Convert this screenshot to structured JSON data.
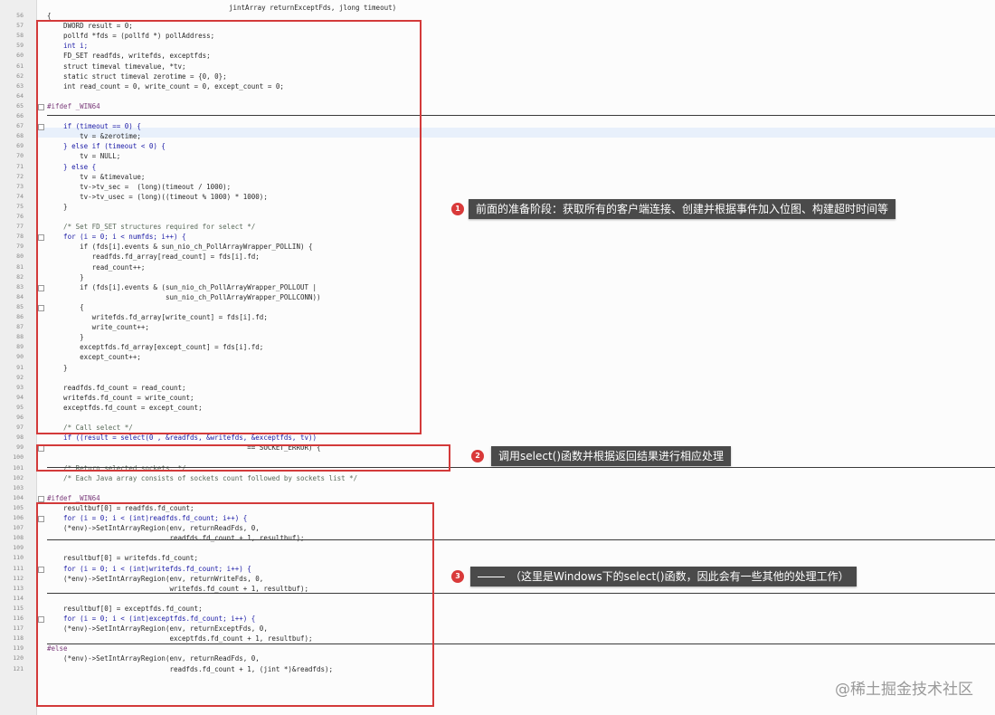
{
  "top_signature": "jintArray returnExceptFds, jlong timeout)",
  "code_lines": [
    {
      "ln": "56",
      "text": "{",
      "cls": ""
    },
    {
      "ln": "57",
      "text": "    DWORD result = 0;",
      "cls": ""
    },
    {
      "ln": "58",
      "text": "    pollfd *fds = (pollfd *) pollAddress;",
      "cls": ""
    },
    {
      "ln": "59",
      "text": "    int i;",
      "cls": "kw"
    },
    {
      "ln": "60",
      "text": "    FD_SET readfds, writefds, exceptfds;",
      "cls": ""
    },
    {
      "ln": "61",
      "text": "    struct timeval timevalue, *tv;",
      "cls": ""
    },
    {
      "ln": "62",
      "text": "    static struct timeval zerotime = {0, 0};",
      "cls": ""
    },
    {
      "ln": "63",
      "text": "    int read_count = 0, write_count = 0, except_count = 0;",
      "cls": ""
    },
    {
      "ln": "64",
      "text": "",
      "cls": ""
    },
    {
      "ln": "65",
      "text": "#ifdef _WIN64",
      "cls": "pp"
    },
    {
      "ln": "66",
      "text": "",
      "cls": ""
    },
    {
      "ln": "67",
      "text": "    if (timeout == 0) {",
      "cls": "kw"
    },
    {
      "ln": "68",
      "text": "        tv = &zerotime;",
      "cls": ""
    },
    {
      "ln": "69",
      "text": "    } else if (timeout < 0) {",
      "cls": "kw"
    },
    {
      "ln": "70",
      "text": "        tv = NULL;",
      "cls": ""
    },
    {
      "ln": "71",
      "text": "    } else {",
      "cls": "kw"
    },
    {
      "ln": "72",
      "text": "        tv = &timevalue;",
      "cls": ""
    },
    {
      "ln": "73",
      "text": "        tv->tv_sec =  (long)(timeout / 1000);",
      "cls": ""
    },
    {
      "ln": "74",
      "text": "        tv->tv_usec = (long)((timeout % 1000) * 1000);",
      "cls": ""
    },
    {
      "ln": "75",
      "text": "    }",
      "cls": ""
    },
    {
      "ln": "76",
      "text": "",
      "cls": ""
    },
    {
      "ln": "77",
      "text": "    /* Set FD_SET structures required for select */",
      "cls": "cm"
    },
    {
      "ln": "78",
      "text": "    for (i = 0; i < numfds; i++) {",
      "cls": "kw"
    },
    {
      "ln": "79",
      "text": "        if (fds[i].events & sun_nio_ch_PollArrayWrapper_POLLIN) {",
      "cls": ""
    },
    {
      "ln": "80",
      "text": "           readfds.fd_array[read_count] = fds[i].fd;",
      "cls": ""
    },
    {
      "ln": "81",
      "text": "           read_count++;",
      "cls": ""
    },
    {
      "ln": "82",
      "text": "        }",
      "cls": ""
    },
    {
      "ln": "83",
      "text": "        if (fds[i].events & (sun_nio_ch_PollArrayWrapper_POLLOUT |",
      "cls": ""
    },
    {
      "ln": "84",
      "text": "                             sun_nio_ch_PollArrayWrapper_POLLCONN))",
      "cls": ""
    },
    {
      "ln": "85",
      "text": "        {",
      "cls": ""
    },
    {
      "ln": "86",
      "text": "           writefds.fd_array[write_count] = fds[i].fd;",
      "cls": ""
    },
    {
      "ln": "87",
      "text": "           write_count++;",
      "cls": ""
    },
    {
      "ln": "88",
      "text": "        }",
      "cls": ""
    },
    {
      "ln": "89",
      "text": "        exceptfds.fd_array[except_count] = fds[i].fd;",
      "cls": ""
    },
    {
      "ln": "90",
      "text": "        except_count++;",
      "cls": ""
    },
    {
      "ln": "91",
      "text": "    }",
      "cls": ""
    },
    {
      "ln": "92",
      "text": "",
      "cls": ""
    },
    {
      "ln": "93",
      "text": "    readfds.fd_count = read_count;",
      "cls": ""
    },
    {
      "ln": "94",
      "text": "    writefds.fd_count = write_count;",
      "cls": ""
    },
    {
      "ln": "95",
      "text": "    exceptfds.fd_count = except_count;",
      "cls": ""
    },
    {
      "ln": "96",
      "text": "",
      "cls": ""
    },
    {
      "ln": "97",
      "text": "    /* Call select */",
      "cls": "cm"
    },
    {
      "ln": "98",
      "text": "    if ((result = select(0 , &readfds, &writefds, &exceptfds, tv))",
      "cls": "kw"
    },
    {
      "ln": "99",
      "text": "                                                 == SOCKET_ERROR) {",
      "cls": ""
    },
    {
      "ln": "100",
      "text": "",
      "cls": ""
    },
    {
      "ln": "101",
      "text": "    /* Return selected sockets. */",
      "cls": "cm"
    },
    {
      "ln": "102",
      "text": "    /* Each Java array consists of sockets count followed by sockets list */",
      "cls": "cm"
    },
    {
      "ln": "103",
      "text": "",
      "cls": ""
    },
    {
      "ln": "104",
      "text": "#ifdef _WIN64",
      "cls": "pp"
    },
    {
      "ln": "105",
      "text": "    resultbuf[0] = readfds.fd_count;",
      "cls": ""
    },
    {
      "ln": "106",
      "text": "    for (i = 0; i < (int)readfds.fd_count; i++) {",
      "cls": "kw"
    },
    {
      "ln": "107",
      "text": "    (*env)->SetIntArrayRegion(env, returnReadFds, 0,",
      "cls": ""
    },
    {
      "ln": "108",
      "text": "                              readfds.fd_count + 1, resultbuf);",
      "cls": ""
    },
    {
      "ln": "109",
      "text": "",
      "cls": ""
    },
    {
      "ln": "110",
      "text": "    resultbuf[0] = writefds.fd_count;",
      "cls": ""
    },
    {
      "ln": "111",
      "text": "    for (i = 0; i < (int)writefds.fd_count; i++) {",
      "cls": "kw"
    },
    {
      "ln": "112",
      "text": "    (*env)->SetIntArrayRegion(env, returnWriteFds, 0,",
      "cls": ""
    },
    {
      "ln": "113",
      "text": "                              writefds.fd_count + 1, resultbuf);",
      "cls": ""
    },
    {
      "ln": "114",
      "text": "",
      "cls": ""
    },
    {
      "ln": "115",
      "text": "    resultbuf[0] = exceptfds.fd_count;",
      "cls": ""
    },
    {
      "ln": "116",
      "text": "    for (i = 0; i < (int)exceptfds.fd_count; i++) {",
      "cls": "kw"
    },
    {
      "ln": "117",
      "text": "    (*env)->SetIntArrayRegion(env, returnExceptFds, 0,",
      "cls": ""
    },
    {
      "ln": "118",
      "text": "                              exceptfds.fd_count + 1, resultbuf);",
      "cls": ""
    },
    {
      "ln": "119",
      "text": "#else",
      "cls": "pp"
    },
    {
      "ln": "120",
      "text": "    (*env)->SetIntArrayRegion(env, returnReadFds, 0,",
      "cls": ""
    },
    {
      "ln": "121",
      "text": "                              readfds.fd_count + 1, (jint *)&readfds);",
      "cls": ""
    }
  ],
  "annotations": [
    {
      "badge": "1",
      "text": "前面的准备阶段：获取所有的客户端连接、创建并根据事件加入位图、构建超时时间等"
    },
    {
      "badge": "2",
      "text": "调用select()函数并根据返回结果进行相应处理"
    },
    {
      "badge": "3",
      "text": "（这里是Windows下的select()函数，因此会有一些其他的处理工作）"
    }
  ],
  "watermark": "@稀土掘金技术社区",
  "colors": {
    "highlight_box": "#d33a3a",
    "callout_bg": "#4a4a4a",
    "current_line": "#e8f0fb"
  }
}
